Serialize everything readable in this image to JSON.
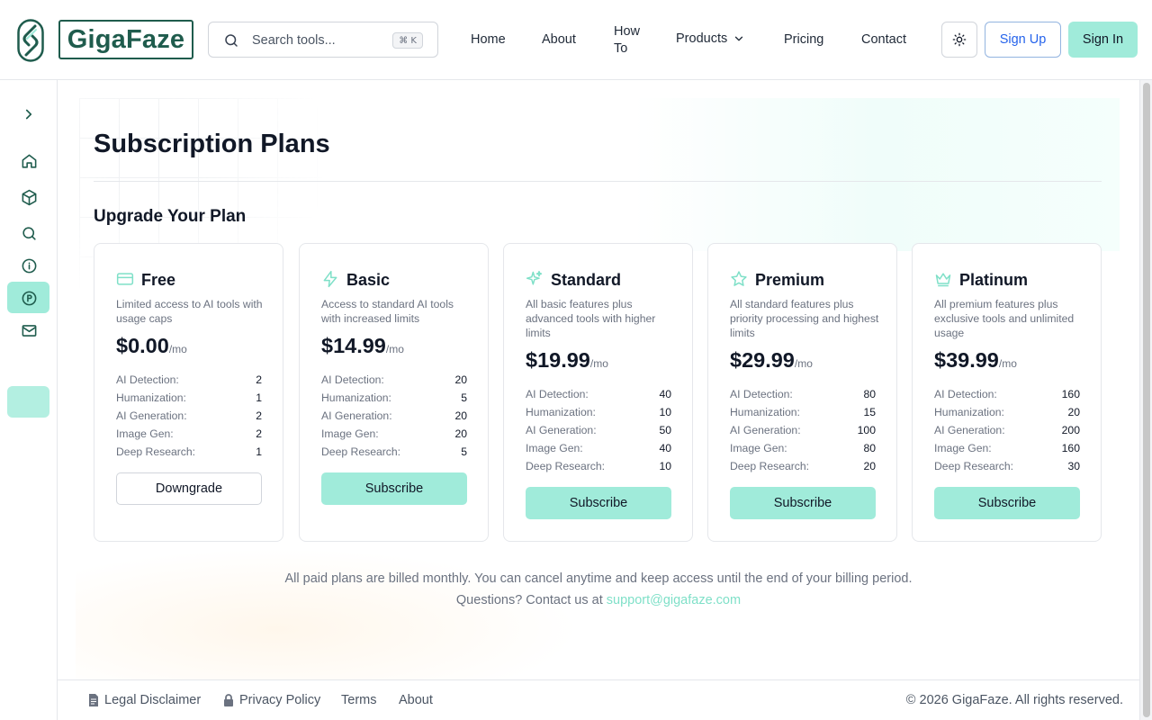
{
  "header": {
    "brand": "GigaFaze",
    "search_placeholder": "Search tools...",
    "search_shortcut": "⌘ K",
    "nav": {
      "home": "Home",
      "about": "About",
      "howto_line1": "How",
      "howto_line2": "To",
      "products": "Products",
      "pricing": "Pricing",
      "contact": "Contact"
    },
    "signup_label": "Sign Up",
    "signin_label": "Sign In"
  },
  "sidebar": {
    "items": [
      "expand",
      "home",
      "products",
      "search",
      "about",
      "pricing",
      "contact"
    ],
    "active": "pricing"
  },
  "main": {
    "title": "Subscription Plans",
    "section_title": "Upgrade Your Plan",
    "per_month": "/mo",
    "plans": [
      {
        "name": "Free",
        "icon": "credit-card-icon",
        "description": "Limited access to AI tools with usage caps",
        "price": "$0.00",
        "limits": [
          {
            "label": "AI Detection:",
            "value": "2"
          },
          {
            "label": "Humanization:",
            "value": "1"
          },
          {
            "label": "AI Generation:",
            "value": "2"
          },
          {
            "label": "Image Gen:",
            "value": "2"
          },
          {
            "label": "Deep Research:",
            "value": "1"
          }
        ],
        "button": "Downgrade"
      },
      {
        "name": "Basic",
        "icon": "lightning-icon",
        "description": "Access to standard AI tools with increased limits",
        "price": "$14.99",
        "limits": [
          {
            "label": "AI Detection:",
            "value": "20"
          },
          {
            "label": "Humanization:",
            "value": "5"
          },
          {
            "label": "AI Generation:",
            "value": "20"
          },
          {
            "label": "Image Gen:",
            "value": "20"
          },
          {
            "label": "Deep Research:",
            "value": "5"
          }
        ],
        "button": "Subscribe"
      },
      {
        "name": "Standard",
        "icon": "sparkles-icon",
        "description": "All basic features plus advanced tools with higher limits",
        "price": "$19.99",
        "limits": [
          {
            "label": "AI Detection:",
            "value": "40"
          },
          {
            "label": "Humanization:",
            "value": "10"
          },
          {
            "label": "AI Generation:",
            "value": "50"
          },
          {
            "label": "Image Gen:",
            "value": "40"
          },
          {
            "label": "Deep Research:",
            "value": "10"
          }
        ],
        "button": "Subscribe"
      },
      {
        "name": "Premium",
        "icon": "star-icon",
        "description": "All standard features plus priority processing and highest limits",
        "price": "$29.99",
        "limits": [
          {
            "label": "AI Detection:",
            "value": "80"
          },
          {
            "label": "Humanization:",
            "value": "15"
          },
          {
            "label": "AI Generation:",
            "value": "100"
          },
          {
            "label": "Image Gen:",
            "value": "80"
          },
          {
            "label": "Deep Research:",
            "value": "20"
          }
        ],
        "button": "Subscribe"
      },
      {
        "name": "Platinum",
        "icon": "crown-icon",
        "description": "All premium features plus exclusive tools and unlimited usage",
        "price": "$39.99",
        "limits": [
          {
            "label": "AI Detection:",
            "value": "160"
          },
          {
            "label": "Humanization:",
            "value": "20"
          },
          {
            "label": "AI Generation:",
            "value": "200"
          },
          {
            "label": "Image Gen:",
            "value": "160"
          },
          {
            "label": "Deep Research:",
            "value": "30"
          }
        ],
        "button": "Subscribe"
      }
    ],
    "billing_note": "All paid plans are billed monthly. You can cancel anytime and keep access until the end of your billing period.",
    "questions_prefix": "Questions? Contact us at ",
    "support_email": "support@gigafaze.com"
  },
  "footer": {
    "legal": "Legal Disclaimer",
    "privacy": "Privacy Policy",
    "terms": "Terms",
    "about": "About",
    "copyright": "© 2026 GigaFaze. All rights reserved."
  },
  "colors": {
    "brand": "#1f5c4d",
    "accent": "#a0ebda",
    "link_blue": "#2563eb",
    "email_link": "#7fe0c8"
  }
}
